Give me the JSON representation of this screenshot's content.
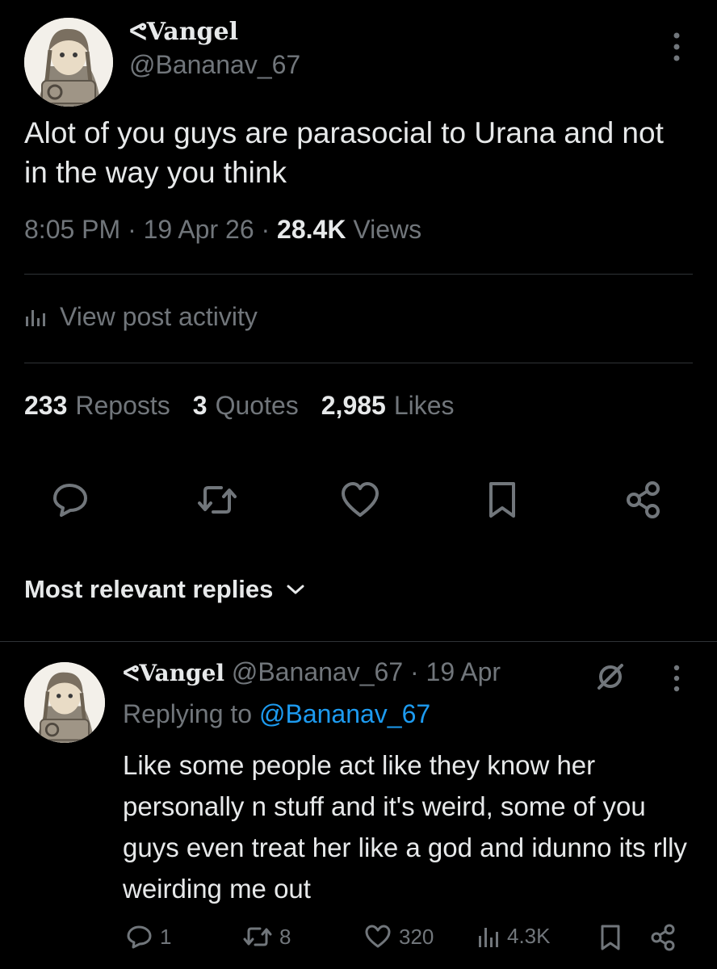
{
  "post": {
    "author_name": "ᕙVangel",
    "author_handle": "@Bananav_67",
    "text": "Alot of you guys are parasocial to Urana and not in the way you think",
    "time": "8:05 PM",
    "date": "19 Apr 26",
    "views_count": "28.4K",
    "views_label": "Views",
    "activity_label": "View post activity",
    "reposts_count": "233",
    "reposts_label": "Reposts",
    "quotes_count": "3",
    "quotes_label": "Quotes",
    "likes_count": "2,985",
    "likes_label": "Likes"
  },
  "replies_header": "Most relevant replies",
  "reply": {
    "author_name": "ᕙVangel",
    "author_handle": "@Bananav_67",
    "date": "19 Apr",
    "replying_prefix": "Replying to",
    "replying_to": "@Bananav_67",
    "text": "Like some people act like they know her personally n stuff and it's weird, some of you guys even treat her like a god and idunno its rlly weirding me out",
    "reply_count": "1",
    "repost_count": "8",
    "like_count": "320",
    "view_count": "4.3K"
  },
  "icons": {
    "more": "more-dots-icon",
    "reply": "reply-bubble-icon",
    "repost": "repost-icon",
    "like": "heart-icon",
    "bookmark": "bookmark-icon",
    "share": "share-icon",
    "views": "bar-chart-icon",
    "grok": "grok-icon",
    "chevron": "chevron-down-icon"
  },
  "colors": {
    "background": "#000000",
    "text": "#e7e9ea",
    "muted": "#71767b",
    "link": "#1d9bf0",
    "divider": "#2f3336"
  }
}
